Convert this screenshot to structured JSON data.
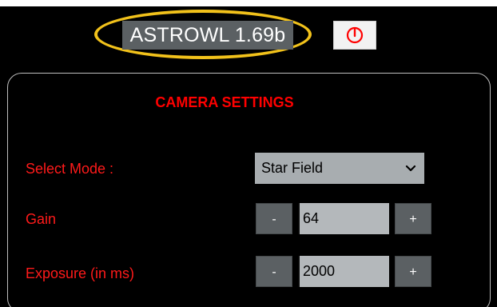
{
  "header": {
    "title": "ASTROWL 1.69b",
    "power_icon": "power-icon"
  },
  "colors": {
    "accent_red": "#ff0000",
    "highlight_yellow": "#f2c21b",
    "button_gray": "#5b6063",
    "field_gray": "#b4b8bb"
  },
  "panel": {
    "title": "CAMERA SETTINGS",
    "mode": {
      "label": "Select Mode :",
      "selected": "Star Field"
    },
    "gain": {
      "label": "Gain",
      "value": "64",
      "minus": "-",
      "plus": "+"
    },
    "exposure": {
      "label": "Exposure (in ms)",
      "value": "2000",
      "minus": "-",
      "plus": "+"
    }
  }
}
